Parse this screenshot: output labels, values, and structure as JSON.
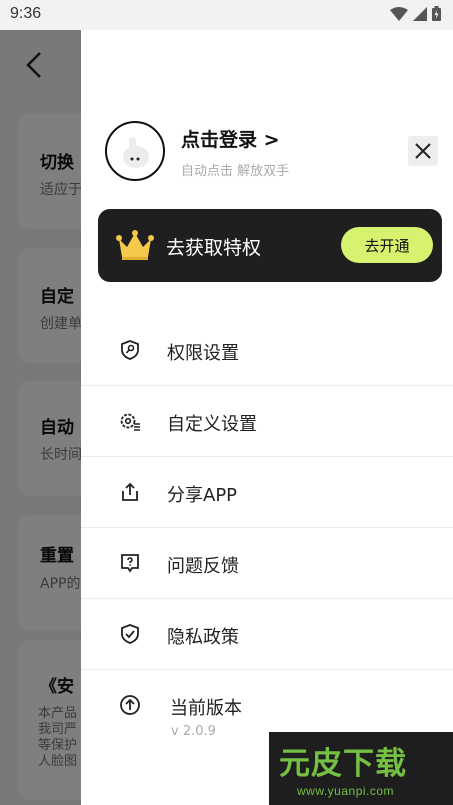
{
  "status_bar": {
    "time": "9:36"
  },
  "background": {
    "cards": [
      {
        "title": "切换",
        "subtitle": "适应于"
      },
      {
        "title": "自定",
        "subtitle": "创建单"
      },
      {
        "title": "自动",
        "subtitle": "长时间"
      },
      {
        "title": "重置",
        "subtitle": "APP的"
      },
      {
        "title": "《安",
        "body_lines": [
          "本产品",
          "我司严",
          "等保护",
          "人脸图"
        ]
      }
    ]
  },
  "drawer": {
    "login_title": "点击登录 >",
    "login_subtitle": "自动点击 解放双手",
    "vip": {
      "text": "去获取特权",
      "button": "去开通",
      "accent_color": "#d7f26f"
    },
    "menu": [
      {
        "label": "权限设置",
        "icon": "shield-key-icon"
      },
      {
        "label": "自定义设置",
        "icon": "gear-list-icon"
      },
      {
        "label": "分享APP",
        "icon": "share-icon"
      },
      {
        "label": "问题反馈",
        "icon": "question-chat-icon"
      },
      {
        "label": "隐私政策",
        "icon": "shield-check-icon"
      },
      {
        "label": "当前版本",
        "icon": "arrow-up-circle-icon",
        "version": "v 2.0.9"
      }
    ]
  },
  "watermark": {
    "main": "元皮下载",
    "url": "www.yuanpi.com"
  }
}
